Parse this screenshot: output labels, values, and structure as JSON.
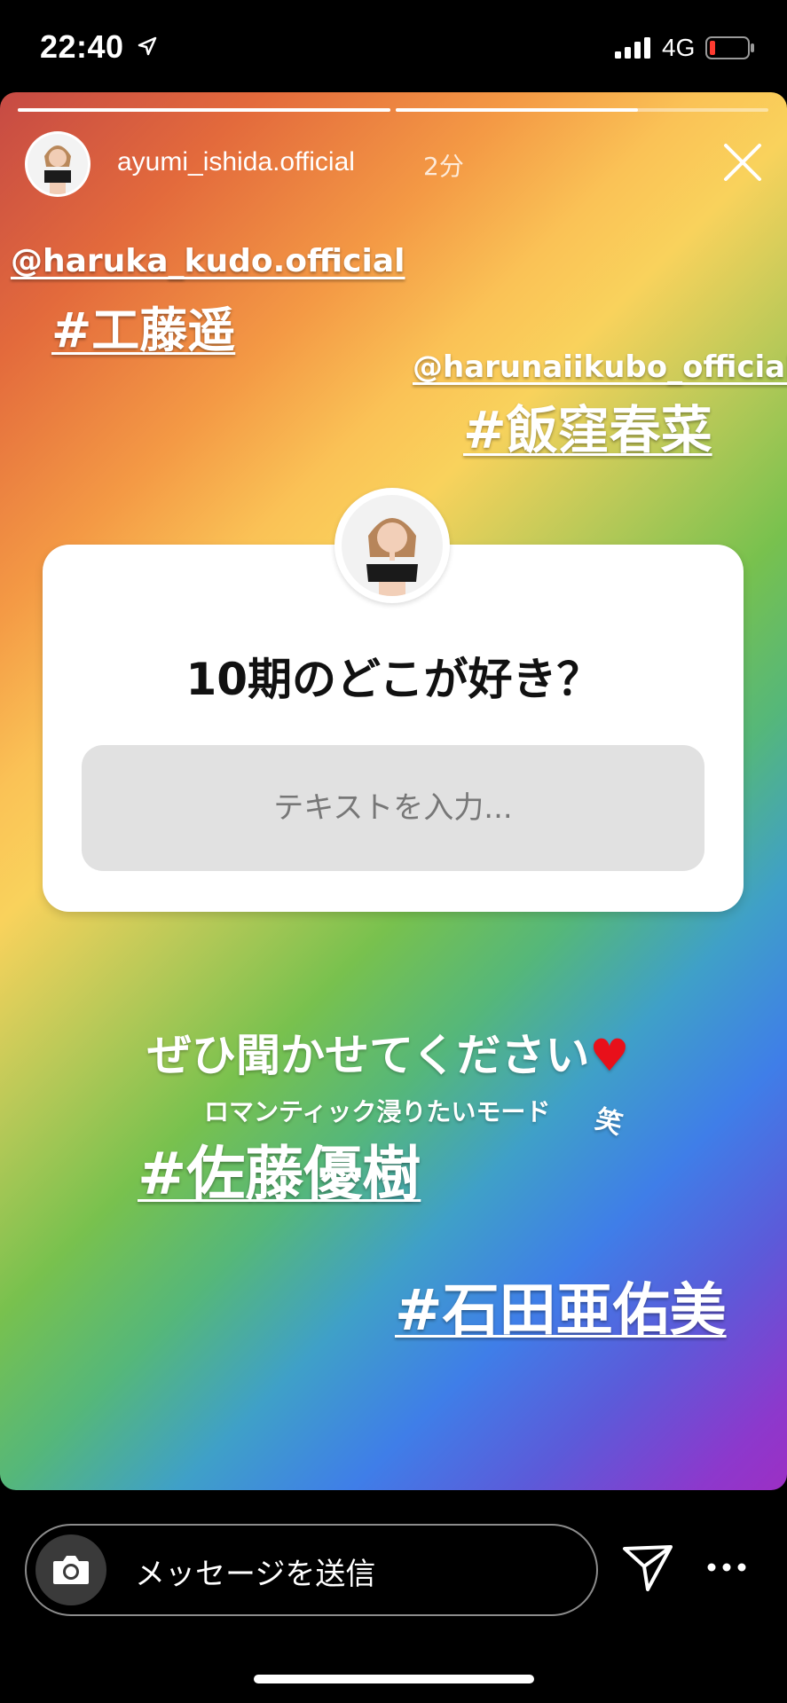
{
  "status_bar": {
    "time": "22:40",
    "network": "4G",
    "battery_level": 0.1,
    "battery_color": "#ff3b30"
  },
  "story": {
    "progress": [
      1.0,
      0.65
    ],
    "username": "ayumi_ishida.official",
    "time_ago": "2分",
    "close_icon": "close-icon",
    "mention_1": "@haruka_kudo.official",
    "hashtag_1": "#工藤遥",
    "mention_2": "@harunaiikubo_official",
    "hashtag_2": "#飯窪春菜",
    "question_sticker": {
      "question": "10期のどこが好き？",
      "placeholder": "テキストを入力..."
    },
    "caption_main": "ぜひ聞かせてください",
    "caption_heart": "♥",
    "caption_sub": "ロマンティック浸りたいモード",
    "caption_laugh": "笑",
    "hashtag_3": "#佐藤優樹",
    "hashtag_4": "#石田亜佑美"
  },
  "bottom_bar": {
    "camera_icon": "camera-icon",
    "message_placeholder": "メッセージを送信",
    "send_icon": "paper-plane-icon",
    "more_icon": "more-horizontal-icon"
  },
  "colors": {
    "heart": "#e8101a",
    "answer_box": "#e1e1e1"
  }
}
